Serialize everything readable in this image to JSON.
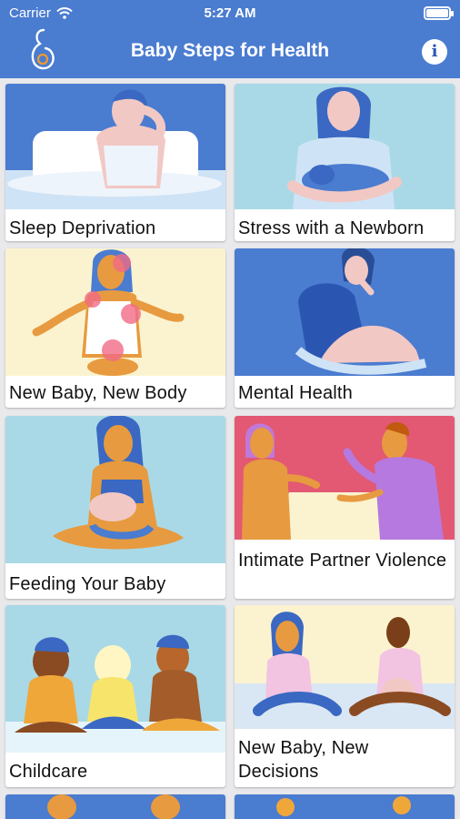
{
  "status_bar": {
    "carrier": "Carrier",
    "time": "5:27 AM"
  },
  "header": {
    "title": "Baby Steps for Health",
    "info_icon": "info-icon",
    "logo_icon": "pregnancy-logo-icon"
  },
  "colors": {
    "header_bg": "#4a7cd0",
    "sky_blue": "#a9d9e6",
    "cream": "#fbf3cf",
    "pink": "#e35873",
    "royal_blue": "#4a7cd0"
  },
  "topics": [
    {
      "label": "Sleep Deprivation"
    },
    {
      "label": "Stress with a Newborn"
    },
    {
      "label": "New Baby, New Body"
    },
    {
      "label": "Mental Health"
    },
    {
      "label": "Feeding Your Baby"
    },
    {
      "label": "Intimate Partner Violence"
    },
    {
      "label": "Childcare"
    },
    {
      "label": "New Baby, New Decisions"
    }
  ]
}
